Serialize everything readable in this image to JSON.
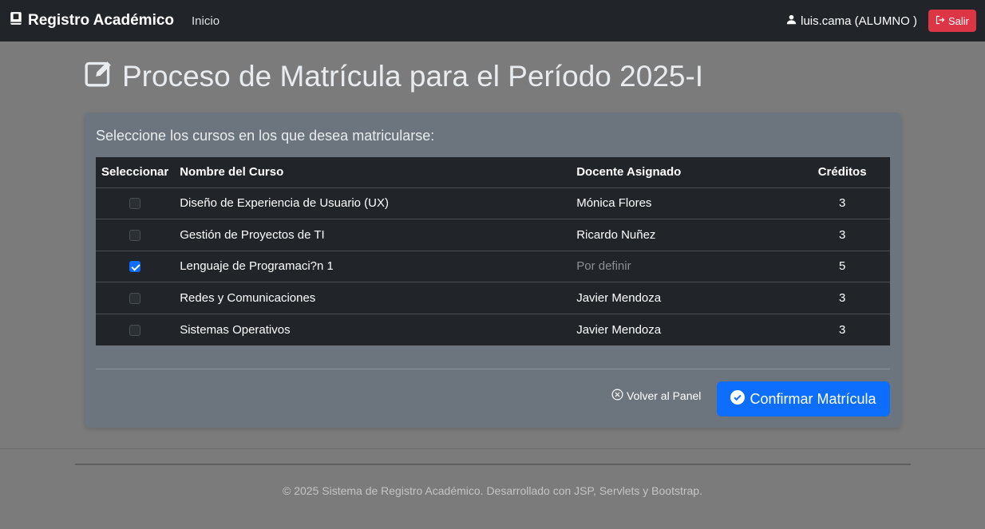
{
  "navbar": {
    "brand": "Registro Académico",
    "home_link": "Inicio",
    "user": "luis.cama (ALUMNO )",
    "logout": "Salir",
    "icons": {
      "brand": "book-icon",
      "user": "person-icon",
      "logout": "logout-icon"
    }
  },
  "page": {
    "title": "Proceso de Matrícula para el Período 2025-I",
    "title_icon": "edit-icon"
  },
  "card": {
    "intro": "Seleccione los cursos en los que desea matricularse:",
    "table": {
      "headers": [
        "Seleccionar",
        "Nombre del Curso",
        "Docente Asignado",
        "Créditos"
      ],
      "rows": [
        {
          "selected": false,
          "course": "Diseño de Experiencia de Usuario (UX)",
          "teacher": "Mónica Flores",
          "credits": "3"
        },
        {
          "selected": false,
          "course": "Gestión de Proyectos de TI",
          "teacher": "Ricardo Nuñez",
          "credits": "3"
        },
        {
          "selected": true,
          "course": "Lenguaje de Programaci?n 1",
          "teacher": "Por definir",
          "credits": "5"
        },
        {
          "selected": false,
          "course": "Redes y Comunicaciones",
          "teacher": "Javier Mendoza",
          "credits": "3"
        },
        {
          "selected": false,
          "course": "Sistemas Operativos",
          "teacher": "Javier Mendoza",
          "credits": "3"
        }
      ]
    },
    "back_link": "Volver al Panel",
    "confirm_button": "Confirmar Matrícula"
  },
  "footer": {
    "text": "© 2025 Sistema de Registro Académico. Desarrollado con JSP, Servlets y Bootstrap."
  },
  "colors": {
    "navbar_bg": "#212529",
    "logout_bg": "#dc3545",
    "primary": "#0d6efd",
    "card_bg": "#6c757d",
    "page_bg": "#7b7b7b"
  }
}
